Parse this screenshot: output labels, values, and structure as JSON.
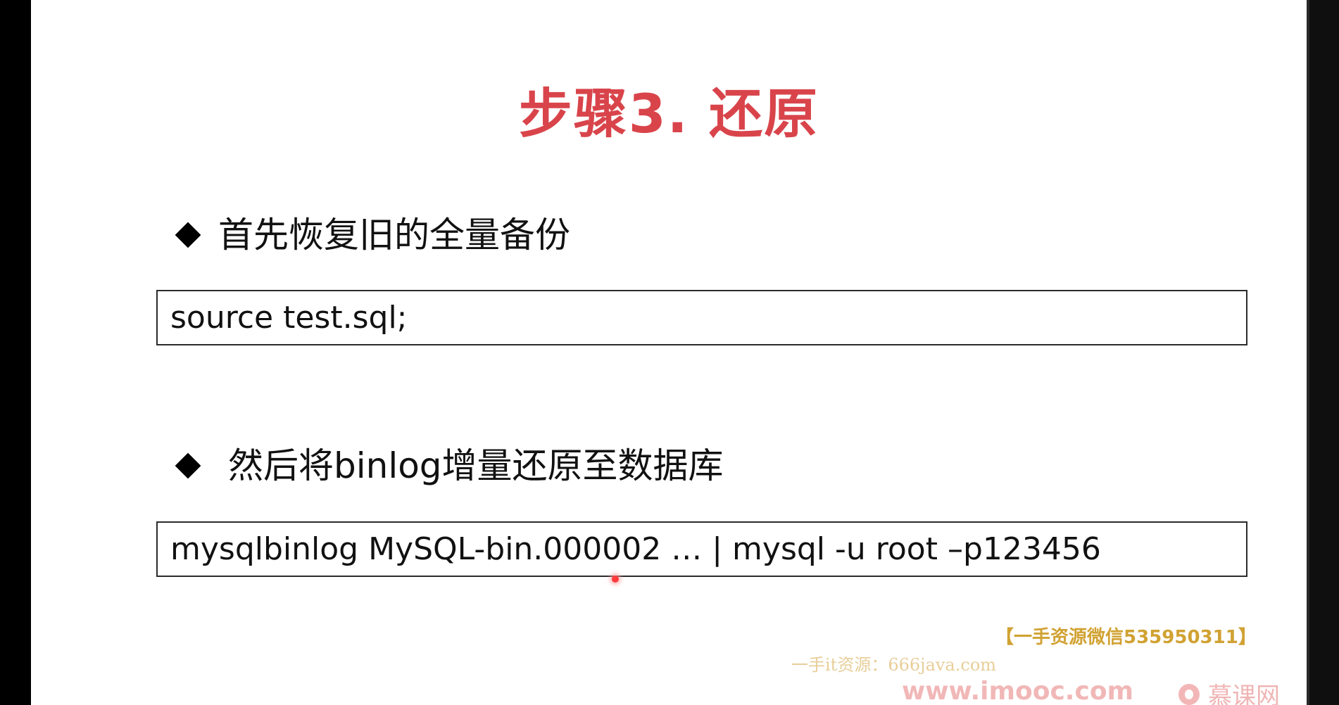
{
  "slide": {
    "title": "步骤3. 还原",
    "bullets": [
      {
        "text": "首先恢复旧的全量备份",
        "code": "source test.sql;"
      },
      {
        "text": "然后将binlog增量还原至数据库",
        "code": "mysqlbinlog MySQL-bin.000002 … | mysql -u root –p123456"
      }
    ]
  },
  "watermarks": {
    "line1": "【一手资源微信535950311】",
    "line2": "一手it资源：666java.com",
    "line3": "www.imooc.com",
    "brand": "慕课网"
  },
  "colors": {
    "title": "#d9444b",
    "slide_background": "#ffffff",
    "frame": "#000000"
  }
}
